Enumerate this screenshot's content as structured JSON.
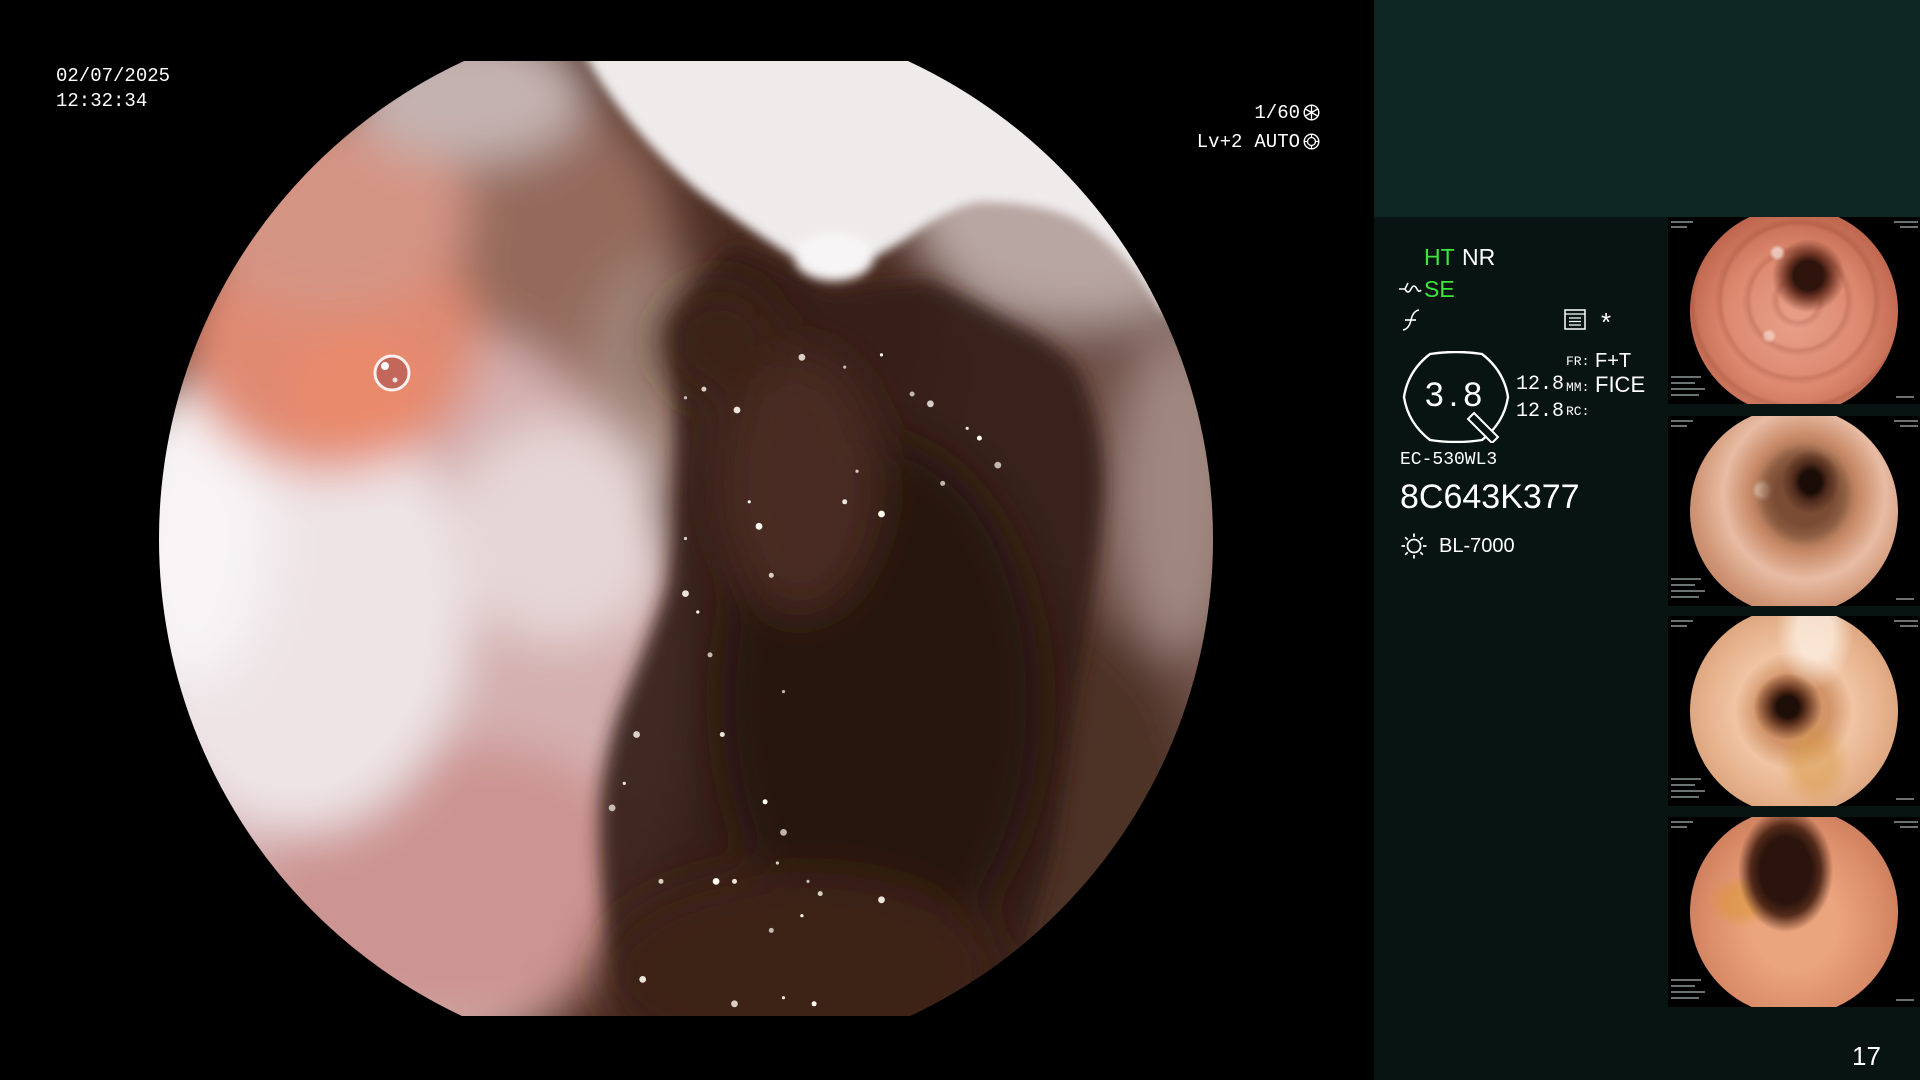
{
  "overlay": {
    "date": "02/07/2025",
    "time": "12:32:34",
    "shutter_speed": "1/60",
    "light_level": "Lv+2",
    "exposure_mode": "AUTO"
  },
  "status": {
    "mode_ht": "HT",
    "mode_nr": "NR",
    "mode_se": "SE",
    "marker": "*"
  },
  "gauge": {
    "value": "3.8"
  },
  "readouts": {
    "value_1": "12.8",
    "value_2": "12.8",
    "fr_label": "FR:",
    "fr_value": "F+T",
    "mm_label": "MM:",
    "mm_value": "FICE",
    "rc_label": "RC:"
  },
  "device": {
    "scope_model": "EC-530WL3",
    "scope_serial": "8C643K377",
    "light_source": "BL-7000"
  },
  "image_count": "17",
  "icons": {
    "shutter": "aperture-icon",
    "exposure": "auto-exposure-icon",
    "structure_enhance": "structure-enhance-icon",
    "color_enhance": "color-curve-icon",
    "image_list": "image-list-icon",
    "zoom_gauge": "zoom-gauge-icon",
    "light_source": "light-source-icon"
  },
  "colors": {
    "accent_green": "#3de63d",
    "text": "#ffffff",
    "background": "#000000",
    "panel_top": "#0e2622",
    "panel_bottom": "#071411"
  }
}
